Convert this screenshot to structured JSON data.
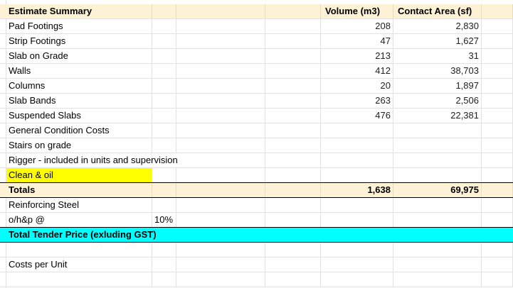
{
  "header": {
    "title": "Estimate Summary",
    "col_volume": "Volume (m3)",
    "col_area": "Contact Area (sf)"
  },
  "rows": [
    {
      "label": "Pad Footings",
      "volume": "208",
      "area": "2,830"
    },
    {
      "label": "Strip Footings",
      "volume": "47",
      "area": "1,627"
    },
    {
      "label": "Slab on Grade",
      "volume": "213",
      "area": "31"
    },
    {
      "label": "Walls",
      "volume": "412",
      "area": "38,703"
    },
    {
      "label": "Columns",
      "volume": "20",
      "area": "1,897"
    },
    {
      "label": "Slab Bands",
      "volume": "263",
      "area": "2,506"
    },
    {
      "label": "Suspended Slabs",
      "volume": "476",
      "area": "22,381"
    },
    {
      "label": "General Condition Costs",
      "volume": "",
      "area": ""
    },
    {
      "label": "Stairs on grade",
      "volume": "",
      "area": ""
    },
    {
      "label": "Rigger - included in units and supervision",
      "volume": "",
      "area": ""
    },
    {
      "label": "Clean & oil",
      "volume": "",
      "area": ""
    }
  ],
  "totals": {
    "label": "Totals",
    "volume": "1,638",
    "area": "69,975"
  },
  "extra": {
    "reinforcing": "Reinforcing Steel",
    "ohp_label": "o/h&p @",
    "ohp_pct": "10%",
    "tender_label": "Total Tender Price (exluding GST)",
    "costs_per_unit": "Costs per Unit"
  },
  "colors": {
    "header_bg": "#fdf1d6",
    "highlight_yellow": "#ffff00",
    "tender_cyan": "#00ffff"
  }
}
